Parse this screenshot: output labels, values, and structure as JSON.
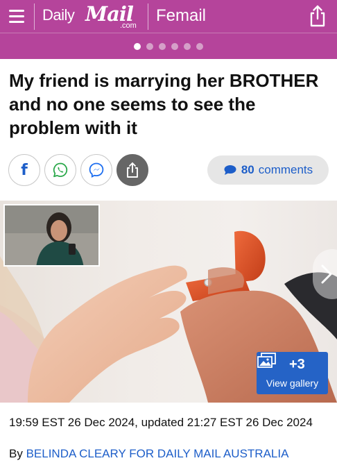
{
  "header": {
    "logo_daily": "Daily",
    "logo_mail": "Mail",
    "logo_com": ".com",
    "section": "Femail",
    "background_color": "#b5449b"
  },
  "carousel": {
    "dot_count": 6,
    "active_index": 0
  },
  "article": {
    "headline": "My friend is marrying her BROTHER and no one seems to see the problem with it",
    "comments_count": "80",
    "comments_label": "comments",
    "dateline": "19:59 EST 26 Dec 2024, updated 21:27 EST 26 Dec 2024",
    "byline_prefix": "By",
    "author": "BELINDA CLEARY FOR DAILY MAIL AUSTRALIA"
  },
  "share": {
    "buttons": [
      "facebook-icon",
      "whatsapp-icon",
      "messenger-icon",
      "share-icon"
    ],
    "facebook_letter": "f"
  },
  "gallery": {
    "count": "+3",
    "label": "View gallery"
  },
  "colors": {
    "link": "#1d5ec9",
    "gallery_button": "#2563c6",
    "brand": "#b5449b"
  }
}
